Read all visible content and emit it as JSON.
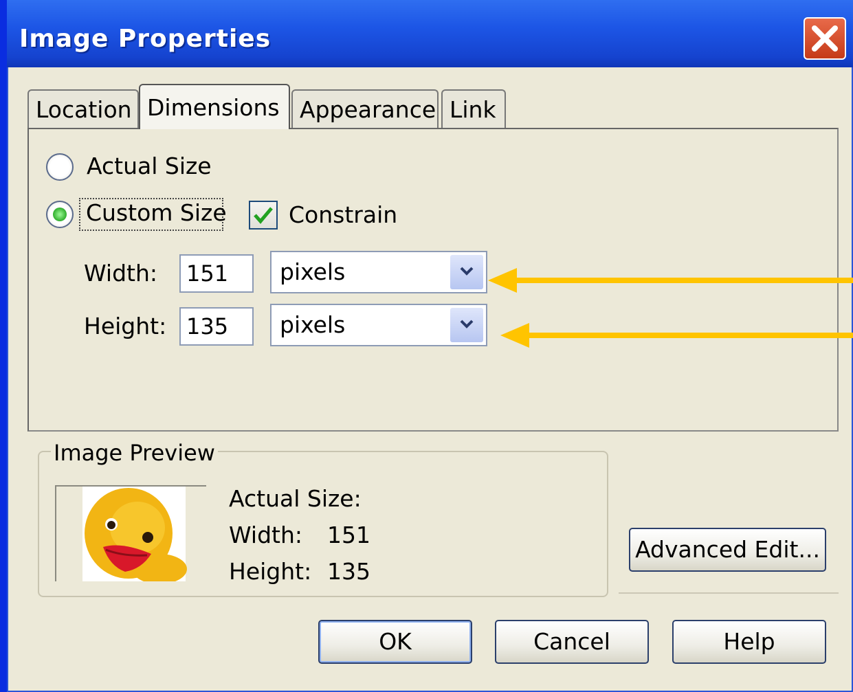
{
  "window": {
    "title": "Image Properties",
    "close_icon": "close-icon"
  },
  "tabs": [
    {
      "label": "Location",
      "active": false
    },
    {
      "label": "Dimensions",
      "active": true
    },
    {
      "label": "Appearance",
      "active": false
    },
    {
      "label": "Link",
      "active": false
    }
  ],
  "dimensions": {
    "actual_size_label": "Actual Size",
    "custom_size_label": "Custom Size",
    "selected": "Custom Size",
    "constrain_label": "Constrain",
    "constrain_checked": true,
    "width_label": "Width:",
    "width_value": "151",
    "width_unit": "pixels",
    "height_label": "Height:",
    "height_value": "135",
    "height_unit": "pixels"
  },
  "preview": {
    "legend": "Image Preview",
    "actual_size_label": "Actual Size:",
    "width_label": "Width:",
    "width_value": "151",
    "height_label": "Height:",
    "height_value": "135"
  },
  "buttons": {
    "advanced_edit": "Advanced Edit...",
    "ok": "OK",
    "cancel": "Cancel",
    "help": "Help"
  },
  "colors": {
    "background": "#0a2de0",
    "titlebar": "#1d56e6",
    "dialog": "#ece9d8",
    "annotation_arrow": "#ffc400"
  }
}
